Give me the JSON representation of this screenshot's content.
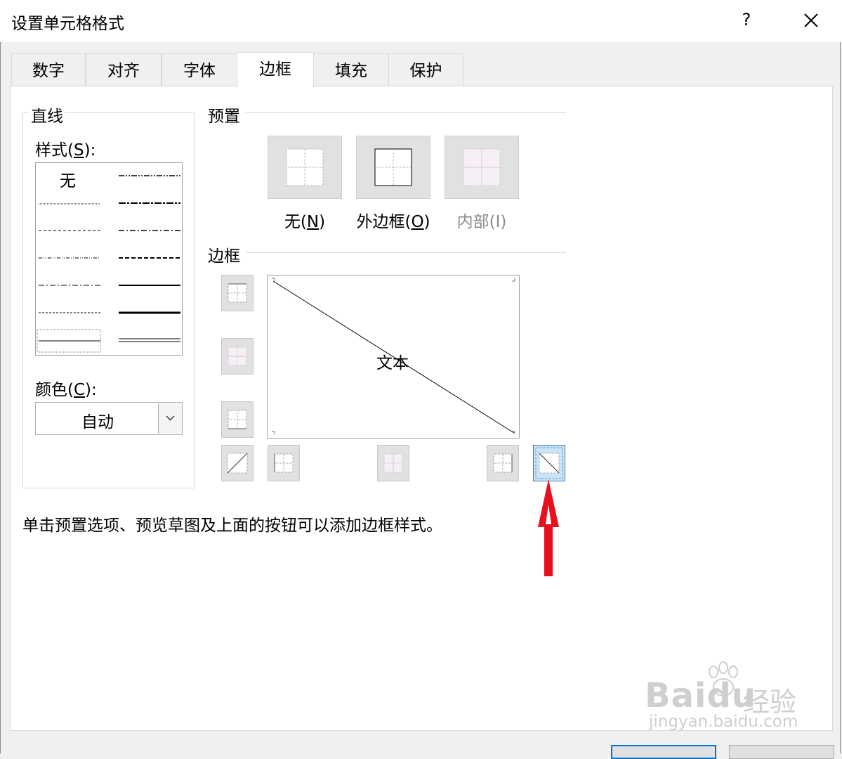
{
  "dialog": {
    "title": "设置单元格格式",
    "help_label": "?",
    "close_label": "✕"
  },
  "tabs": [
    {
      "label": "数字",
      "active": false
    },
    {
      "label": "对齐",
      "active": false
    },
    {
      "label": "字体",
      "active": false
    },
    {
      "label": "边框",
      "active": true
    },
    {
      "label": "填充",
      "active": false
    },
    {
      "label": "保护",
      "active": false
    }
  ],
  "line_group": {
    "title": "直线",
    "style_label": "样式(",
    "style_key": "S",
    "style_suffix": "):",
    "none_label": "无",
    "color_label": "颜色(",
    "color_key": "C",
    "color_suffix": "):",
    "color_value": "自动"
  },
  "presets": {
    "title": "预置",
    "items": [
      {
        "label": "无(",
        "key": "N",
        "suffix": ")",
        "enabled": true
      },
      {
        "label": "外边框(",
        "key": "O",
        "suffix": ")",
        "enabled": true
      },
      {
        "label": "内部(I)",
        "key": "",
        "suffix": "",
        "enabled": false
      }
    ]
  },
  "border": {
    "title": "边框",
    "preview_text": "文本"
  },
  "hint": "单击预置选项、预览草图及上面的按钮可以添加边框样式。",
  "watermark": {
    "brand": "Bai",
    "brand2": "du",
    "brand_cn": "经验",
    "url": "jingyan.baidu.com"
  },
  "colors": {
    "annotation_arrow": "#e8101e",
    "selected_button_bg": "#cce4f7",
    "selected_button_border": "#3c7fb1",
    "disabled_text": "#8a8a8a"
  }
}
